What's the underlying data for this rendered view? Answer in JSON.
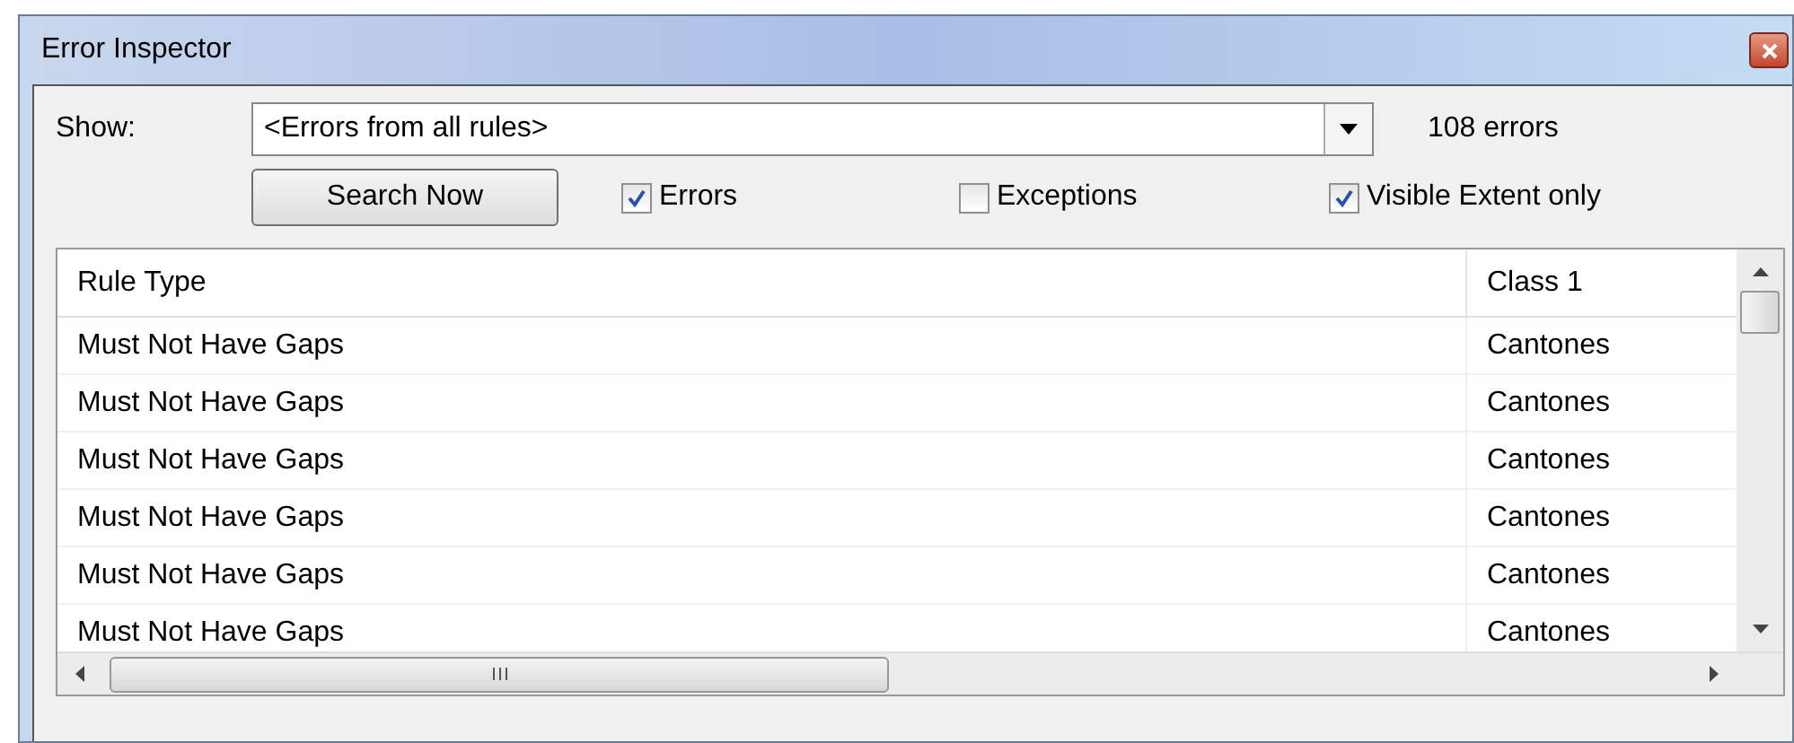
{
  "window": {
    "title": "Error Inspector"
  },
  "show": {
    "label": "Show:",
    "value": "<Errors from all rules>",
    "count": "108 errors"
  },
  "search_button": "Search Now",
  "filters": [
    {
      "label": "Errors",
      "checked": true
    },
    {
      "label": "Exceptions",
      "checked": false
    },
    {
      "label": "Visible Extent only",
      "checked": true
    }
  ],
  "table": {
    "columns": [
      "Rule Type",
      "Class 1"
    ],
    "rows": [
      [
        "Must Not Have Gaps",
        "Cantones"
      ],
      [
        "Must Not Have Gaps",
        "Cantones"
      ],
      [
        "Must Not Have Gaps",
        "Cantones"
      ],
      [
        "Must Not Have Gaps",
        "Cantones"
      ],
      [
        "Must Not Have Gaps",
        "Cantones"
      ],
      [
        "Must Not Have Gaps",
        "Cantones"
      ]
    ]
  }
}
